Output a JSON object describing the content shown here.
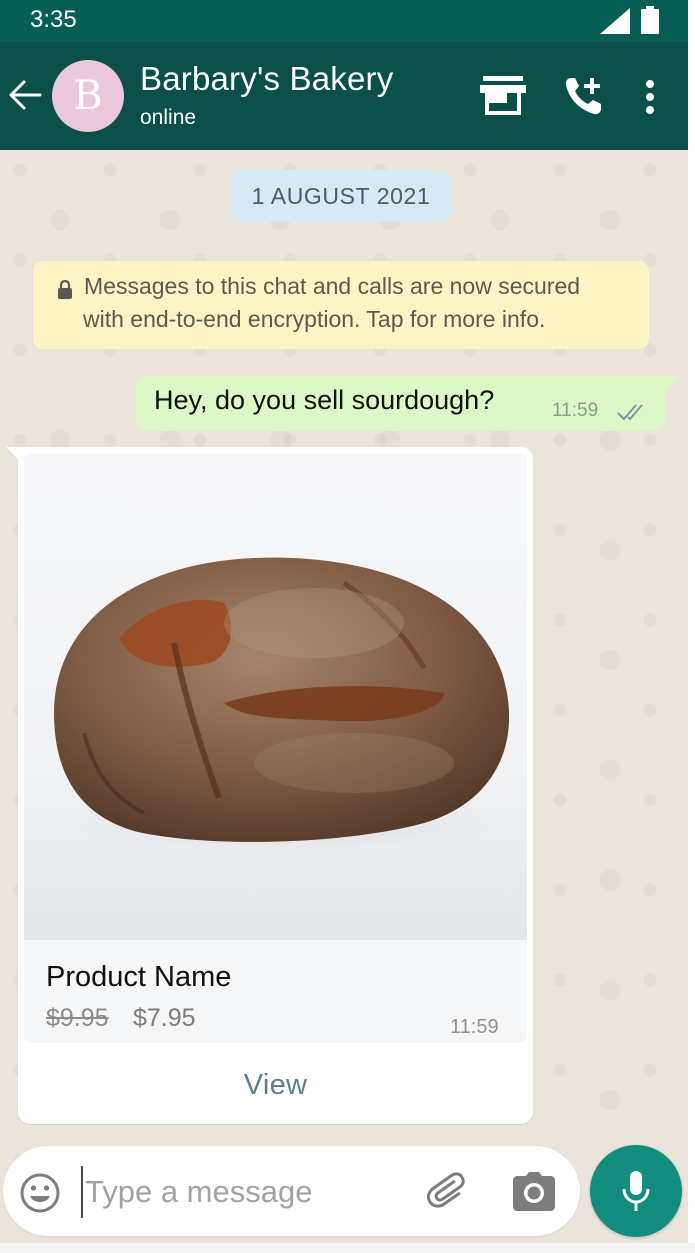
{
  "status_bar": {
    "time": "3:35"
  },
  "header": {
    "title": "Barbary's Bakery",
    "status": "online",
    "avatar_letter": "B"
  },
  "chat": {
    "date": "1 AUGUST 2021",
    "encryption_notice": {
      "line1": "Messages to this chat and calls are now secured",
      "line2": "with end-to-end encryption. Tap for more info."
    },
    "outgoing": {
      "text": "Hey, do you sell sourdough?",
      "time": "11:59"
    },
    "product": {
      "name": "Product Name",
      "old_price": "$9.95",
      "price": "$7.95",
      "time": "11:59",
      "view_label": "View"
    }
  },
  "input": {
    "placeholder": "Type a message",
    "value": ""
  },
  "icons": {
    "back": "arrow-back-icon",
    "store": "store-icon",
    "call": "add-call-icon",
    "menu": "more-vert-icon",
    "emoji": "emoji-icon",
    "attach": "paperclip-icon",
    "camera": "camera-icon",
    "mic": "microphone-icon",
    "lock": "lock-icon",
    "read": "double-check-icon"
  },
  "colors": {
    "header": "#0b4f49",
    "status_bar": "#075e54",
    "outgoing_bubble": "#dcf8c6",
    "notice": "#fdf4c5",
    "date_chip": "#d5eaf4",
    "accent": "#128c7e",
    "wallpaper": "#ebe4da"
  }
}
